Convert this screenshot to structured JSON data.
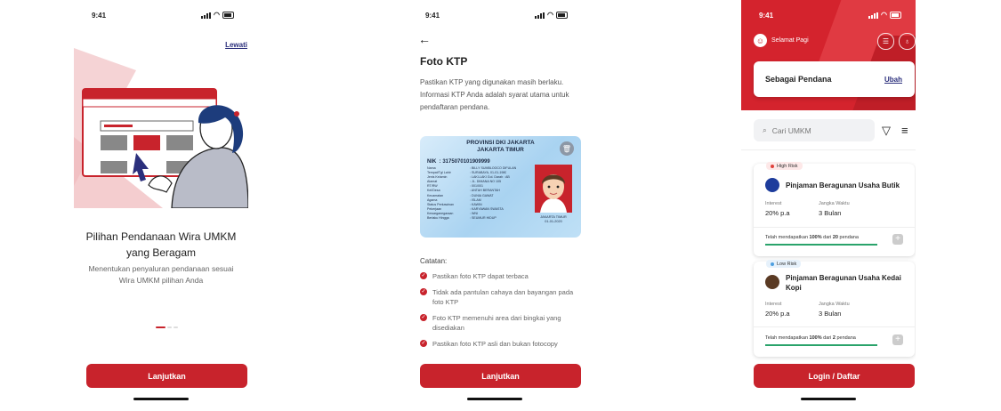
{
  "colors": {
    "primary": "#c8232c",
    "link": "#2b2f7c",
    "success": "#2aa36b",
    "high_risk": "#e0413b",
    "low_risk": "#4d9fe0"
  },
  "status_time": "9:41",
  "onboarding": {
    "skip": "Lewati",
    "title": "Pilihan Pendanaan Wira UMKM yang Beragam",
    "desc": "Menentukan penyaluran pendanaan sesuai Wira UMKM pilihan Anda",
    "continue": "Lanjutkan",
    "page_dots": {
      "count": 3,
      "active": 0
    }
  },
  "ktp_screen": {
    "back_icon": "arrow-left-icon",
    "title": "Foto KTP",
    "desc": "Pastikan KTP yang digunakan masih berlaku. Informasi KTP Anda adalah syarat utama untuk pendaftaran pendana.",
    "card": {
      "province": "PROVINSI DKI JAKARTA",
      "city": "JAKARTA TIMUR",
      "nik_label": "NIK",
      "nik": "3175070101909999",
      "fields": [
        {
          "k": "Nama",
          "v": "BILLY SUMBLOOCO DIFULAN"
        },
        {
          "k": "Tempat/Tgl Lahir",
          "v": "SURABAYA, 01-01-1980"
        },
        {
          "k": "Jenis Kelamin",
          "v": "LAKI-LAKI        Gol. Darah : AB"
        },
        {
          "k": "Alamat",
          "v": "JL. DIMANA NO 105"
        },
        {
          "k": "RT/RW",
          "v": "001/001"
        },
        {
          "k": "Kel/Desa",
          "v": "ANTAH BERANTAH"
        },
        {
          "k": "Kecamatan",
          "v": "DUNIA GAWAT"
        },
        {
          "k": "Agama",
          "v": "ISLAM"
        },
        {
          "k": "Status Perkawinan",
          "v": "KAWIN"
        },
        {
          "k": "Pekerjaan",
          "v": "KARYAWAN SWASTA"
        },
        {
          "k": "Kewarganegaraan",
          "v": "WNI"
        },
        {
          "k": "Berlaku Hingga",
          "v": "SEUMUR HIDUP"
        }
      ],
      "issue_city": "JAKARTA TIMUR",
      "issue_date": "01-01-2020"
    },
    "notes_title": "Catatan:",
    "notes": [
      "Pastikan foto KTP dapat terbaca",
      "Tidak ada pantulan cahaya dan bayangan pada foto KTP",
      "Foto KTP memenuhi area dari bingkai yang disediakan",
      "Pastikan foto KTP asli dan bukan fotocopy"
    ],
    "continue": "Lanjutkan"
  },
  "home": {
    "greeting": "Selamat Pagi",
    "role": "Sebagai Pendana",
    "change": "Ubah",
    "search_placeholder": "Cari UMKM",
    "loans": [
      {
        "risk": "High Risk",
        "name": "Pinjaman Beragunan Usaha Butik",
        "interest_label": "Interest",
        "interest": "20% p.a",
        "tenor_label": "Jangka Waktu",
        "tenor": "3 Bulan",
        "progress_pre": "Telah mendapatkan ",
        "progress_pct": "100%",
        "progress_mid": " dari ",
        "progress_count": "20",
        "progress_post": " pendana",
        "progress_value": 1.0
      },
      {
        "risk": "Low Risk",
        "name": "Pinjaman Beragunan Usaha Kedai Kopi",
        "interest_label": "Interest",
        "interest": "20% p.a",
        "tenor_label": "Jangka Waktu",
        "tenor": "3 Bulan",
        "progress_pre": "Telah mendapatkan ",
        "progress_pct": "100%",
        "progress_mid": " dari ",
        "progress_count": "2",
        "progress_post": " pendana",
        "progress_value": 1.0
      }
    ],
    "login": "Login / Daftar"
  }
}
